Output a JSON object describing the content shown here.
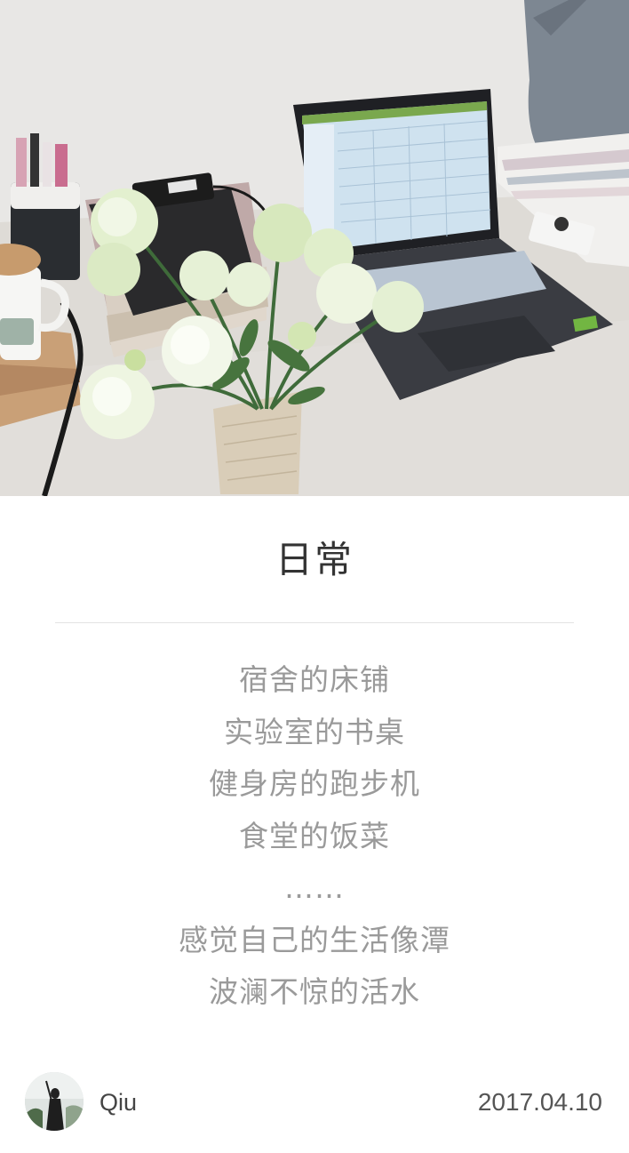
{
  "post": {
    "title": "日常",
    "lines": [
      "宿舍的床铺",
      "实验室的书桌",
      "健身房的跑步机",
      "食堂的饭菜",
      "……",
      "感觉自己的生活像潭",
      "波澜不惊的活水"
    ],
    "author": "Qiu",
    "date": "2017.04.10"
  },
  "colors": {
    "title": "#333333",
    "body_text": "#9a9a9a",
    "divider": "#e3e3e3"
  }
}
